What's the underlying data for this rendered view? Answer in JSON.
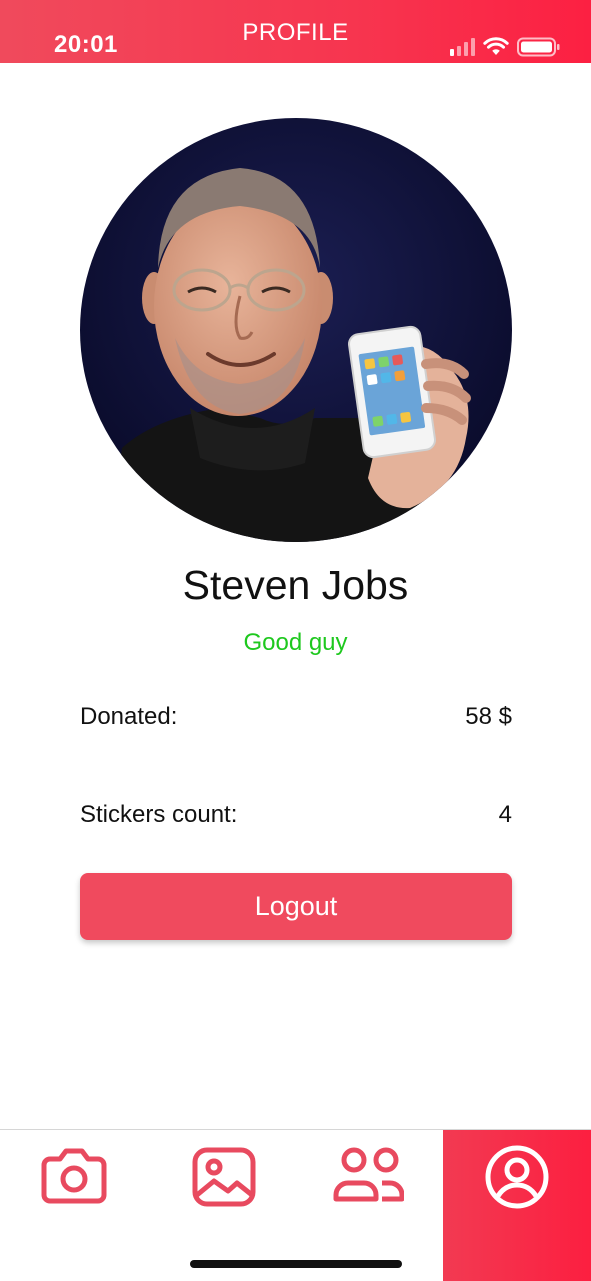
{
  "status_bar": {
    "time": "20:01"
  },
  "header": {
    "title": "PROFILE"
  },
  "profile": {
    "name": "Steven Jobs",
    "subtitle": "Good guy",
    "photo_alt": "Profile photo"
  },
  "stats": [
    {
      "label": "Donated:",
      "value": "58 $"
    },
    {
      "label": "Stickers count:",
      "value": "4"
    }
  ],
  "logout_label": "Logout",
  "nav": {
    "items": [
      {
        "icon": "camera-icon",
        "active": false
      },
      {
        "icon": "image-icon",
        "active": false
      },
      {
        "icon": "users-icon",
        "active": false
      },
      {
        "icon": "profile-icon",
        "active": true
      }
    ]
  },
  "colors": {
    "accent": "#f04a5e",
    "header_start": "#f04a5c",
    "header_end": "#fc2042",
    "subtitle": "#1ec81e",
    "icon": "#e84a5f"
  }
}
